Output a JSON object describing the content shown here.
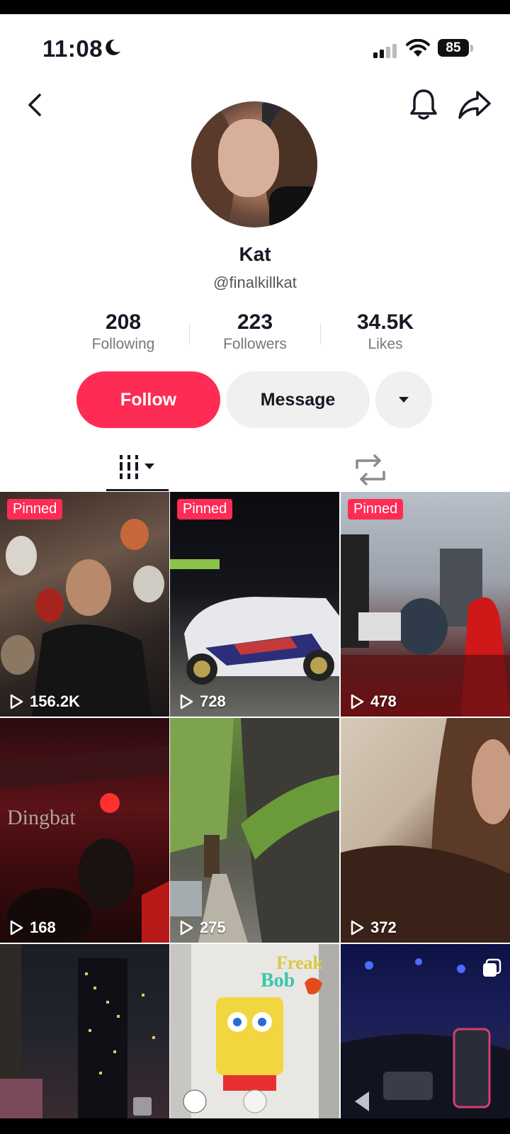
{
  "status_bar": {
    "time": "11:08",
    "battery": "85"
  },
  "profile": {
    "name": "Kat",
    "handle": "@finalkillkat",
    "stats": [
      {
        "value": "208",
        "label": "Following"
      },
      {
        "value": "223",
        "label": "Followers"
      },
      {
        "value": "34.5K",
        "label": "Likes"
      }
    ]
  },
  "actions": {
    "follow_label": "Follow",
    "message_label": "Message"
  },
  "videos": [
    {
      "pinned_label": "Pinned",
      "views": "156.2K"
    },
    {
      "pinned_label": "Pinned",
      "views": "728"
    },
    {
      "pinned_label": "Pinned",
      "views": "478"
    },
    {
      "views": "168"
    },
    {
      "views": "275"
    },
    {
      "views": "372"
    }
  ],
  "thumbnail_text": {
    "sign": "Dingbat",
    "sticker_1": "Freak",
    "sticker_2": "Bob"
  },
  "colors": {
    "accent": "#fe2c55",
    "text": "#161823"
  }
}
